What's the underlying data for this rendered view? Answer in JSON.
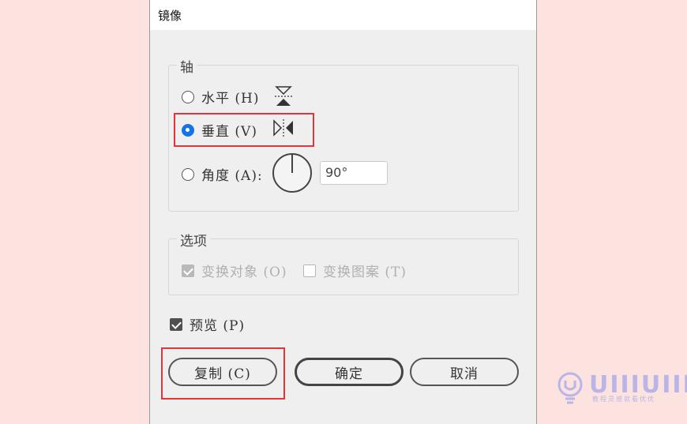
{
  "dialog": {
    "title": "镜像",
    "axis_group": {
      "legend": "轴",
      "horizontal": {
        "label": "水平 (H)",
        "selected": false
      },
      "vertical": {
        "label": "垂直 (V)",
        "selected": true
      },
      "angle": {
        "label": "角度 (A):",
        "selected": false,
        "value": "90°"
      }
    },
    "options_group": {
      "legend": "选项",
      "transform_objects": {
        "label": "变换对象 (O)",
        "checked": true,
        "enabled": false
      },
      "transform_patterns": {
        "label": "变换图案 (T)",
        "checked": false,
        "enabled": false
      }
    },
    "preview": {
      "label": "预览 (P)",
      "checked": true
    },
    "buttons": {
      "copy": "复制 (C)",
      "ok": "确定",
      "cancel": "取消"
    }
  },
  "watermark": {
    "logo_text": "UIIIUIII",
    "subtitle": "教程灵感就看优优"
  },
  "colors": {
    "accent": "#1473e6",
    "highlight": "#e0353b",
    "background": "#fde3df"
  }
}
